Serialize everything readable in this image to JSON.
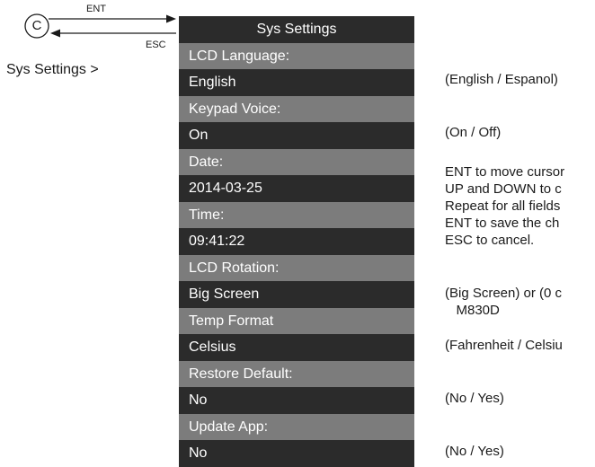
{
  "nav": {
    "circle_letter": "C",
    "ent_label": "ENT",
    "esc_label": "ESC"
  },
  "breadcrumb": "Sys Settings >",
  "panel": {
    "title": "Sys Settings",
    "rows": [
      {
        "kind": "hdr",
        "text": "LCD Language:"
      },
      {
        "kind": "val",
        "text": "English"
      },
      {
        "kind": "hdr",
        "text": "Keypad Voice:"
      },
      {
        "kind": "val",
        "text": "On"
      },
      {
        "kind": "hdr",
        "text": "Date:"
      },
      {
        "kind": "val",
        "text": "2014-03-25"
      },
      {
        "kind": "hdr",
        "text": "Time:"
      },
      {
        "kind": "val",
        "text": "09:41:22"
      },
      {
        "kind": "hdr",
        "text": "LCD Rotation:"
      },
      {
        "kind": "val",
        "text": "Big Screen"
      },
      {
        "kind": "hdr",
        "text": "Temp Format"
      },
      {
        "kind": "val",
        "text": "Celsius"
      },
      {
        "kind": "hdr",
        "text": "Restore Default:"
      },
      {
        "kind": "val",
        "text": "No"
      },
      {
        "kind": "hdr",
        "text": "Update App:"
      },
      {
        "kind": "val",
        "text": "No"
      }
    ]
  },
  "notes": {
    "language": "(English / Espanol)",
    "voice": "(On / Off)",
    "datetime": "ENT to move cursor\nUP and DOWN to c\nRepeat for all fields\nENT to save the ch\nESC to cancel.",
    "rotation": "(Big Screen) or (0 c\n   M830D",
    "temp": "(Fahrenheit / Celsiu",
    "restore": "(No / Yes)",
    "update": "(No / Yes)"
  }
}
